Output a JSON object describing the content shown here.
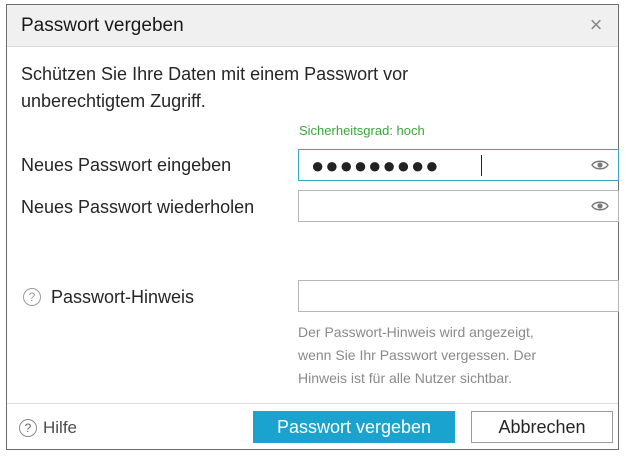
{
  "dialog": {
    "title": "Passwort vergeben",
    "close_glyph": "×",
    "intro_line1": "Schützen Sie Ihre Daten mit einem Passwort vor",
    "intro_line2": "unberechtigtem Zugriff.",
    "strength_label": "Sicherheitsgrad: hoch"
  },
  "form": {
    "new_password_label": "Neues Passwort eingeben",
    "new_password_masked": "●●●●●●●●●",
    "repeat_password_label": "Neues Passwort wiederholen",
    "repeat_password_value": "",
    "hint_label": "Passwort-Hinweis",
    "hint_value": "",
    "hint_help_line1": "Der Passwort-Hinweis wird angezeigt,",
    "hint_help_line2": "wenn Sie Ihr Passwort vergessen. Der",
    "hint_help_line3": "Hinweis ist für alle Nutzer sichtbar."
  },
  "footer": {
    "help_label": "Hilfe",
    "submit_label": "Passwort vergeben",
    "cancel_label": "Abbrechen"
  },
  "icons": {
    "close": "close-icon",
    "eye": "eye-icon",
    "help": "question-icon"
  },
  "colors": {
    "accent": "#1aa3cf",
    "strength_ok": "#3aa63a",
    "focus_border": "#39a6cc"
  }
}
